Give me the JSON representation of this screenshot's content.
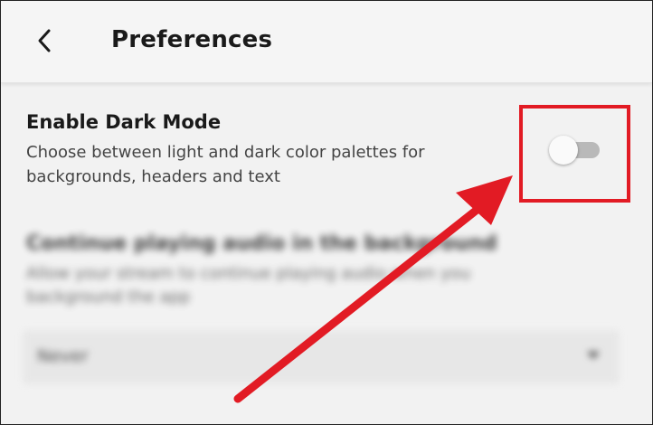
{
  "header": {
    "title": "Preferences",
    "back_icon": "chevron-left-icon"
  },
  "dark_mode": {
    "title": "Enable Dark Mode",
    "description": "Choose between light and dark color palettes for backgrounds, headers and text",
    "enabled": false
  },
  "background_audio": {
    "title": "Continue playing audio in the background",
    "description": "Allow your stream to continue playing audio when you background the app",
    "selected_option": "Never"
  },
  "annotation": {
    "highlight_color": "#e21b24",
    "arrow_color": "#e21b24"
  },
  "colors": {
    "background": "#f2f2f2",
    "toggle_track_off": "#b9b9b9",
    "toggle_thumb": "#fafafa"
  }
}
